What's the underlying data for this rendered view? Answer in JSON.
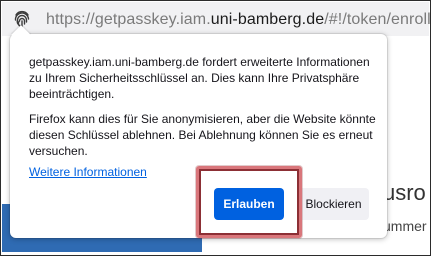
{
  "browser": {
    "url_prefix": "https://getpasskey.iam.",
    "url_domain": "uni-bamberg.de",
    "url_suffix": "/#!/token/enroll//",
    "permission_icon": "fingerprint-icon"
  },
  "background_page": {
    "heading_fragment": "usro",
    "subtext_fragment": "ummer"
  },
  "popup": {
    "message_main": "getpasskey.iam.uni-bamberg.de fordert erweiterte Informationen zu Ihrem Sicherheitsschlüssel an. Dies kann Ihre Privatsphäre beeinträchtigen.",
    "message_secondary": "Firefox kann dies für Sie anonymisieren, aber die Website könnte diesen Schlüssel ablehnen. Bei Ablehnung können Sie es erneut versuchen.",
    "learn_more_label": "Weitere Informationen",
    "allow_label": "Erlauben",
    "block_label": "Blockieren"
  },
  "colors": {
    "accent": "#0061e0",
    "highlight": "#d9767b",
    "page_blue": "#2f6bb3"
  }
}
